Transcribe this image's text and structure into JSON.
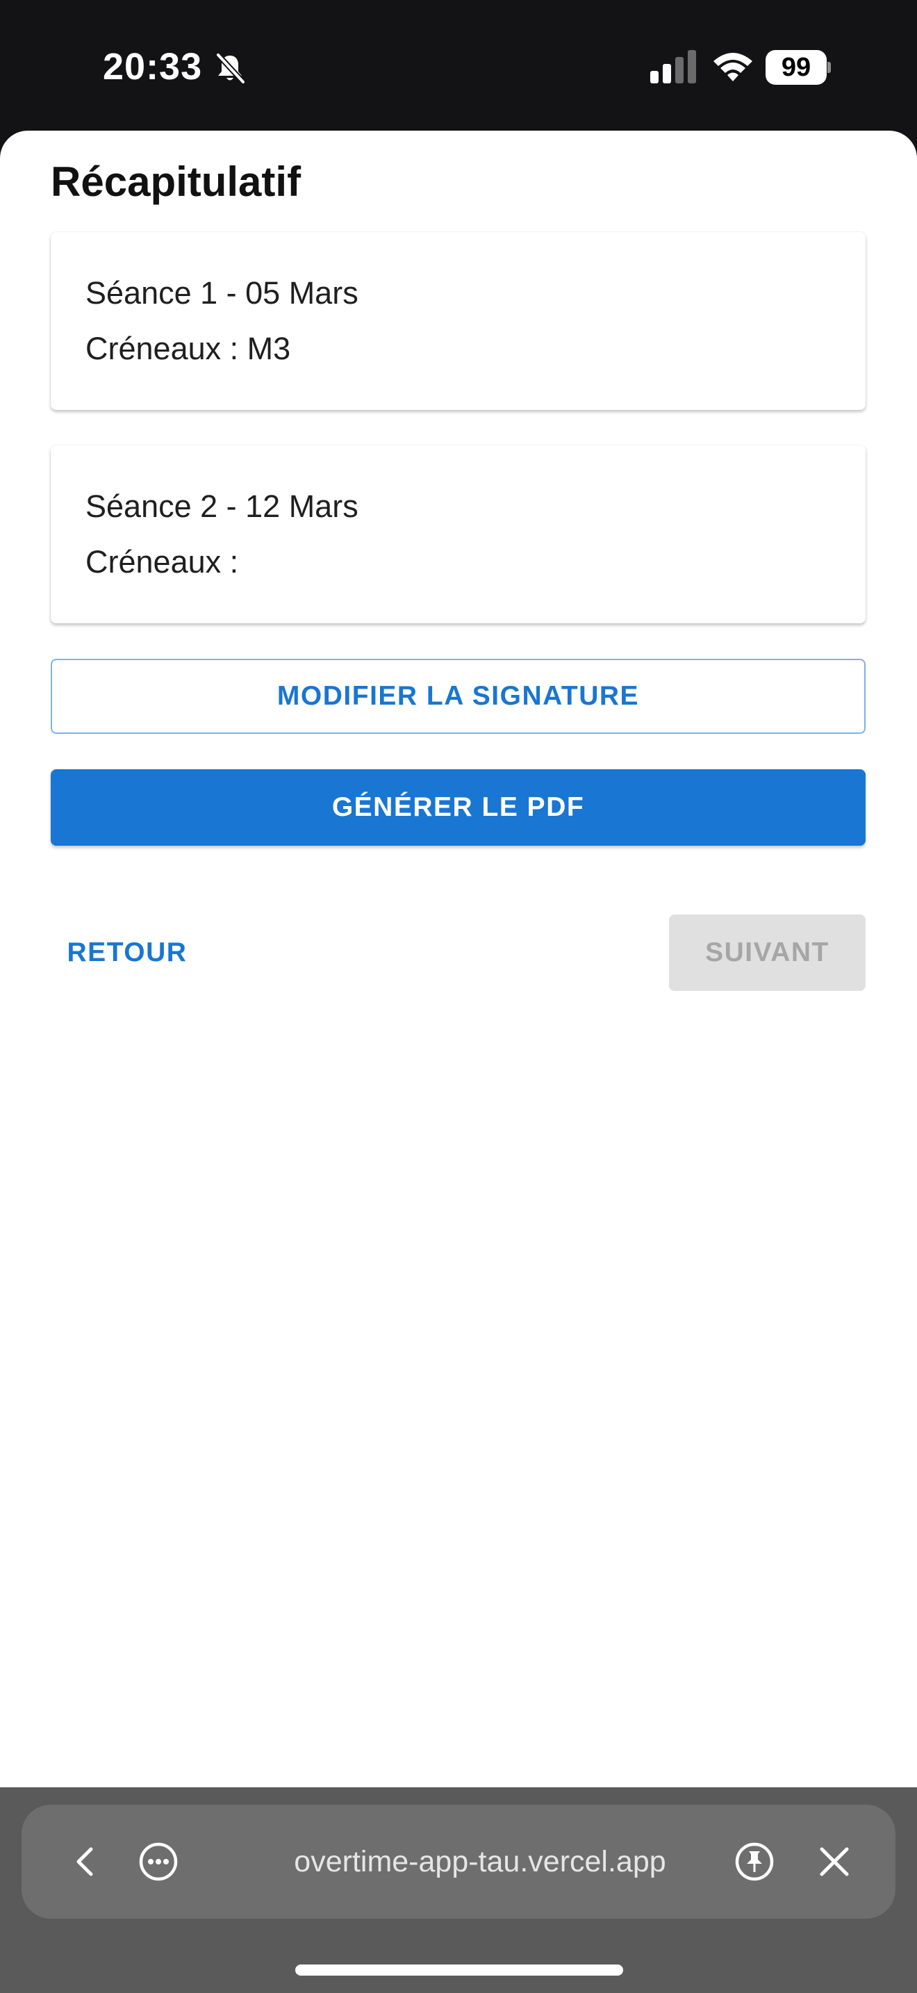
{
  "status_bar": {
    "time": "20:33",
    "battery": "99"
  },
  "page": {
    "title": "Récapitulatif"
  },
  "sessions": [
    {
      "title": "Séance 1 - 05 Mars",
      "slots": "Créneaux : M3"
    },
    {
      "title": "Séance 2 - 12 Mars",
      "slots": "Créneaux :"
    }
  ],
  "actions": {
    "modify_signature": "MODIFIER LA SIGNATURE",
    "generate_pdf": "GÉNÉRER LE PDF",
    "back": "RETOUR",
    "next": "SUIVANT"
  },
  "browser": {
    "url": "overtime-app-tau.vercel.app"
  },
  "colors": {
    "primary": "#1976d2",
    "disabled_bg": "#e0e0e0",
    "disabled_text": "#a6a6a6"
  },
  "icons": [
    "bell-slash-icon",
    "cellular-signal-icon",
    "wifi-icon",
    "battery-icon",
    "chevron-left-icon",
    "more-options-icon",
    "pin-icon",
    "close-icon"
  ]
}
